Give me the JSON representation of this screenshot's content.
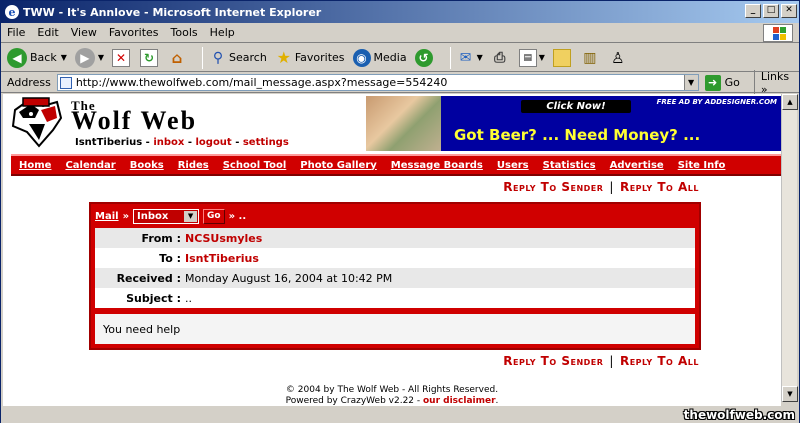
{
  "window": {
    "title": "TWW - It's Annlove - Microsoft Internet Explorer"
  },
  "menu": [
    "File",
    "Edit",
    "View",
    "Favorites",
    "Tools",
    "Help"
  ],
  "toolbar": {
    "back": "Back",
    "search": "Search",
    "favorites": "Favorites",
    "media": "Media"
  },
  "address": {
    "label": "Address",
    "url": "http://www.thewolfweb.com/mail_message.aspx?message=554240",
    "go": "Go",
    "links": "Links"
  },
  "site": {
    "logo_the": "The",
    "logo_name": "Wolf Web",
    "username": "IsntTiberius",
    "user_links": [
      "inbox",
      "logout",
      "settings"
    ],
    "sep": " - "
  },
  "ad": {
    "click": "Click Now!",
    "free": "FREE AD BY ADDESIGNER.COM",
    "text": "Got Beer? ... Need Money? ..."
  },
  "nav": [
    "Home",
    "Calendar",
    "Books",
    "Rides",
    "School Tool",
    "Photo Gallery",
    "Message Boards",
    "Users",
    "Statistics",
    "Advertise",
    "Site Info"
  ],
  "reply": {
    "sender": "Reply To Sender",
    "pipe": "|",
    "all": "Reply To All"
  },
  "mail": {
    "crumb": "Mail",
    "arrow": "»",
    "folder": "Inbox",
    "go": "Go",
    "tail": "» ..",
    "fields": [
      {
        "label": "From :",
        "value": "NCSUsmyles",
        "red": true
      },
      {
        "label": "To :",
        "value": "IsntTiberius",
        "red": true
      },
      {
        "label": "Received :",
        "value": "Monday August 16, 2004 at 10:42 PM",
        "red": false
      },
      {
        "label": "Subject :",
        "value": "..",
        "red": false
      }
    ],
    "body": "You need help"
  },
  "footer": {
    "copyright": "© 2004 by The Wolf Web - All Rights Reserved.",
    "powered": "Powered by CrazyWeb v2.22 - ",
    "disclaimer": "our disclaimer",
    "period": "."
  },
  "watermark": "thewolfweb.com"
}
